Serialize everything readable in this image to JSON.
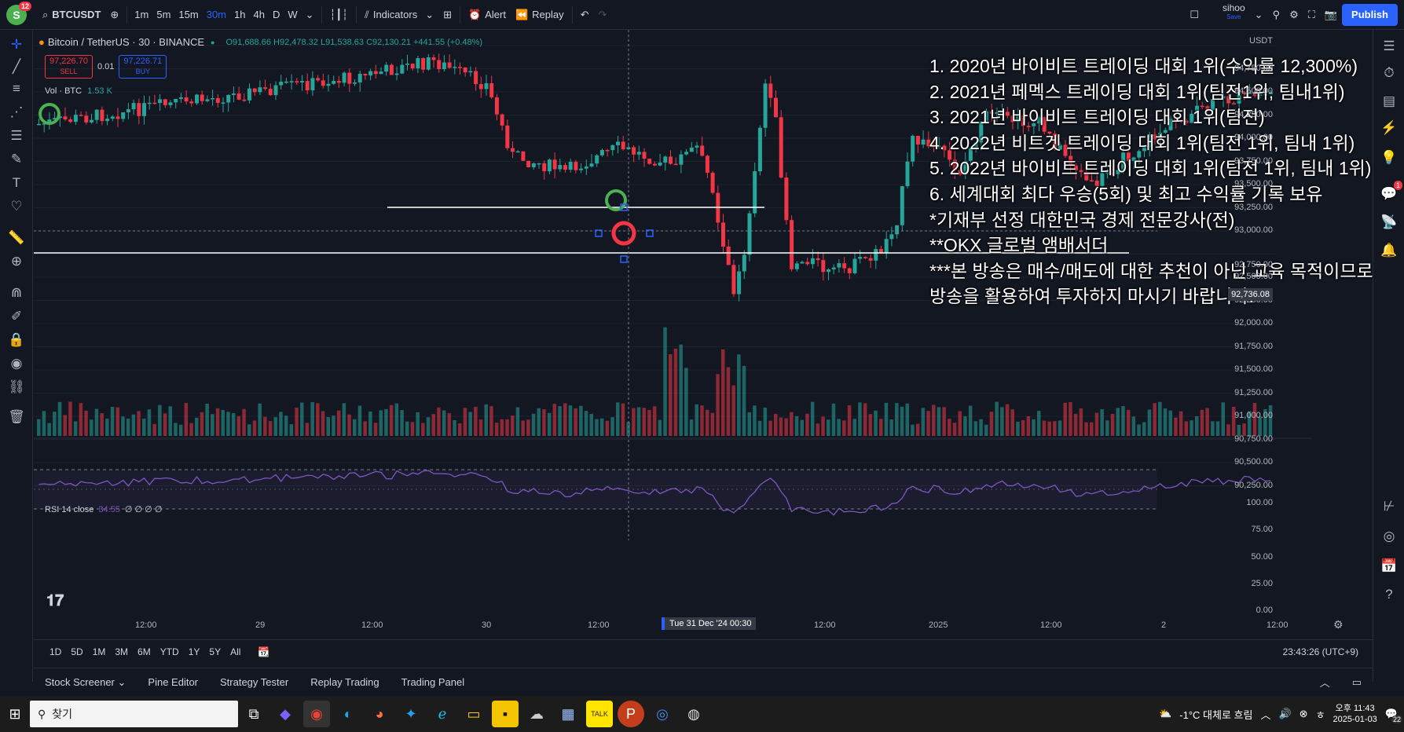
{
  "topbar": {
    "avatar_letter": "S",
    "avatar_badge": "12",
    "symbol": "BTCUSDT",
    "timeframes": [
      "1m",
      "5m",
      "15m",
      "30m",
      "1h",
      "4h",
      "D",
      "W"
    ],
    "active_timeframe": "30m",
    "indicators_label": "Indicators",
    "alert_label": "Alert",
    "replay_label": "Replay",
    "user_name": "sihoo",
    "user_status": "Save",
    "publish_label": "Publish"
  },
  "legend": {
    "title": "Bitcoin / TetherUS · 30 · BINANCE",
    "ohlc": "O91,688.66 H92,478.32 L91,538.63 C92,130.21 +441.55 (+0.48%)",
    "sell_price": "97,226.70",
    "sell_label": "SELL",
    "spread": "0.01",
    "buy_price": "97,226.71",
    "buy_label": "BUY",
    "volume": "Vol · BTC",
    "volume_value": "1.53 K"
  },
  "rsi": {
    "label": "RSI 14 close",
    "value": "34.55",
    "extra": "∅ ∅ ∅ ∅"
  },
  "overlay_lines": [
    "1. 2020년 바이비트 트레이딩 대회 1위(수익률 12,300%)",
    "2. 2021년 페멕스 트레이딩 대회 1위(팀전1위, 팀내1위)",
    "3. 2021년 바이비트 트레이딩 대회 1위(팀전)",
    "4. 2022년 비트겟 트레이딩 대회 1위(팀전 1위, 팀내 1위)",
    "5. 2022년 바이비트 트레이딩 대회 1위(팀전 1위, 팀내 1위)",
    "6. 세계대회 최다 우승(5회) 및 최고 수익률 기록 보유",
    "*기재부 선정 대한민국 경제 전문강사(전)",
    "**OKX 글로벌 앰배서더",
    "***본 방송은 매수/매도에 대한 추천이 아닌 교육 목적이므로",
    " 방송을 활용하여 투자하지 마시기 바랍니다."
  ],
  "price_axis": {
    "currency": "USDT",
    "ticks": [
      "94,750.00",
      "94,500.00",
      "94,250.00",
      "94,000.00",
      "93,750.00",
      "93,500.00",
      "93,250.00",
      "93,000.00",
      "92,750.00",
      "92,500.00",
      "92,250.00",
      "92,000.00",
      "91,750.00",
      "91,500.00",
      "91,250.00",
      "91,000.00",
      "90,750.00",
      "90,500.00",
      "90,250.00"
    ],
    "current_price": "92,736.08",
    "rsi_ticks": [
      "100.00",
      "75.00",
      "50.00",
      "25.00",
      "0.00"
    ]
  },
  "time_axis": {
    "labels": [
      "12:00",
      "29",
      "12:00",
      "30",
      "12:00",
      "12:00",
      "2025",
      "12:00",
      "2",
      "12:00"
    ],
    "crosshair": "Tue 31 Dec '24   00:30"
  },
  "range_bar": {
    "ranges": [
      "1D",
      "5D",
      "1M",
      "3M",
      "6M",
      "YTD",
      "1Y",
      "5Y",
      "All"
    ],
    "clock": "23:43:26 (UTC+9)"
  },
  "bottom_panel": {
    "tabs": [
      "Stock Screener",
      "Pine Editor",
      "Strategy Tester",
      "Replay Trading",
      "Trading Panel"
    ]
  },
  "taskbar": {
    "search_placeholder": "찾기",
    "weather": "-1°C 대체로 흐림",
    "time": "오후 11:43",
    "date": "2025-01-03",
    "notification_count": "22"
  },
  "colors": {
    "bg": "#131722",
    "up": "#26a69a",
    "down": "#f23645",
    "accent": "#2962ff",
    "rsi": "#7e57c2"
  }
}
